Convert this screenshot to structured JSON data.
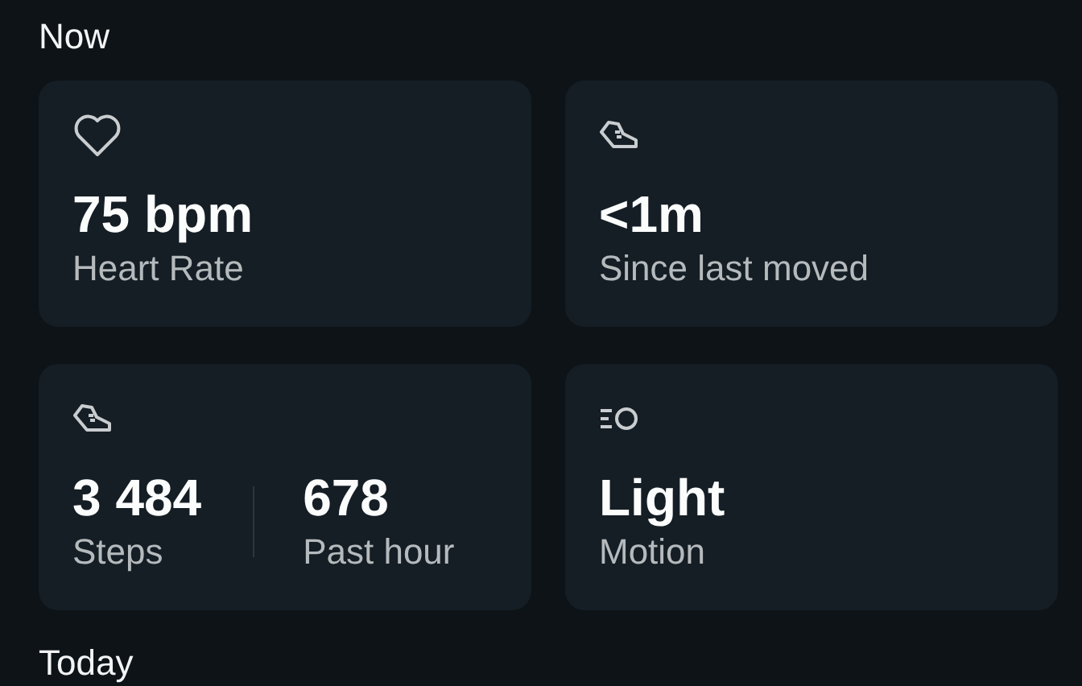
{
  "sections": [
    {
      "title": "Now",
      "cards": [
        {
          "kind": "heart",
          "metrics": [
            {
              "value": "75 bpm",
              "label": "Heart Rate"
            }
          ]
        },
        {
          "kind": "shoe",
          "metrics": [
            {
              "value": "<1m",
              "label": "Since last moved"
            }
          ]
        },
        {
          "kind": "shoe",
          "metrics": [
            {
              "value": "3 484",
              "label": "Steps"
            },
            {
              "value": "678",
              "label": "Past hour"
            }
          ]
        },
        {
          "kind": "motion",
          "metrics": [
            {
              "value": "Light",
              "label": "Motion"
            }
          ]
        }
      ]
    },
    {
      "title": "Today"
    }
  ]
}
